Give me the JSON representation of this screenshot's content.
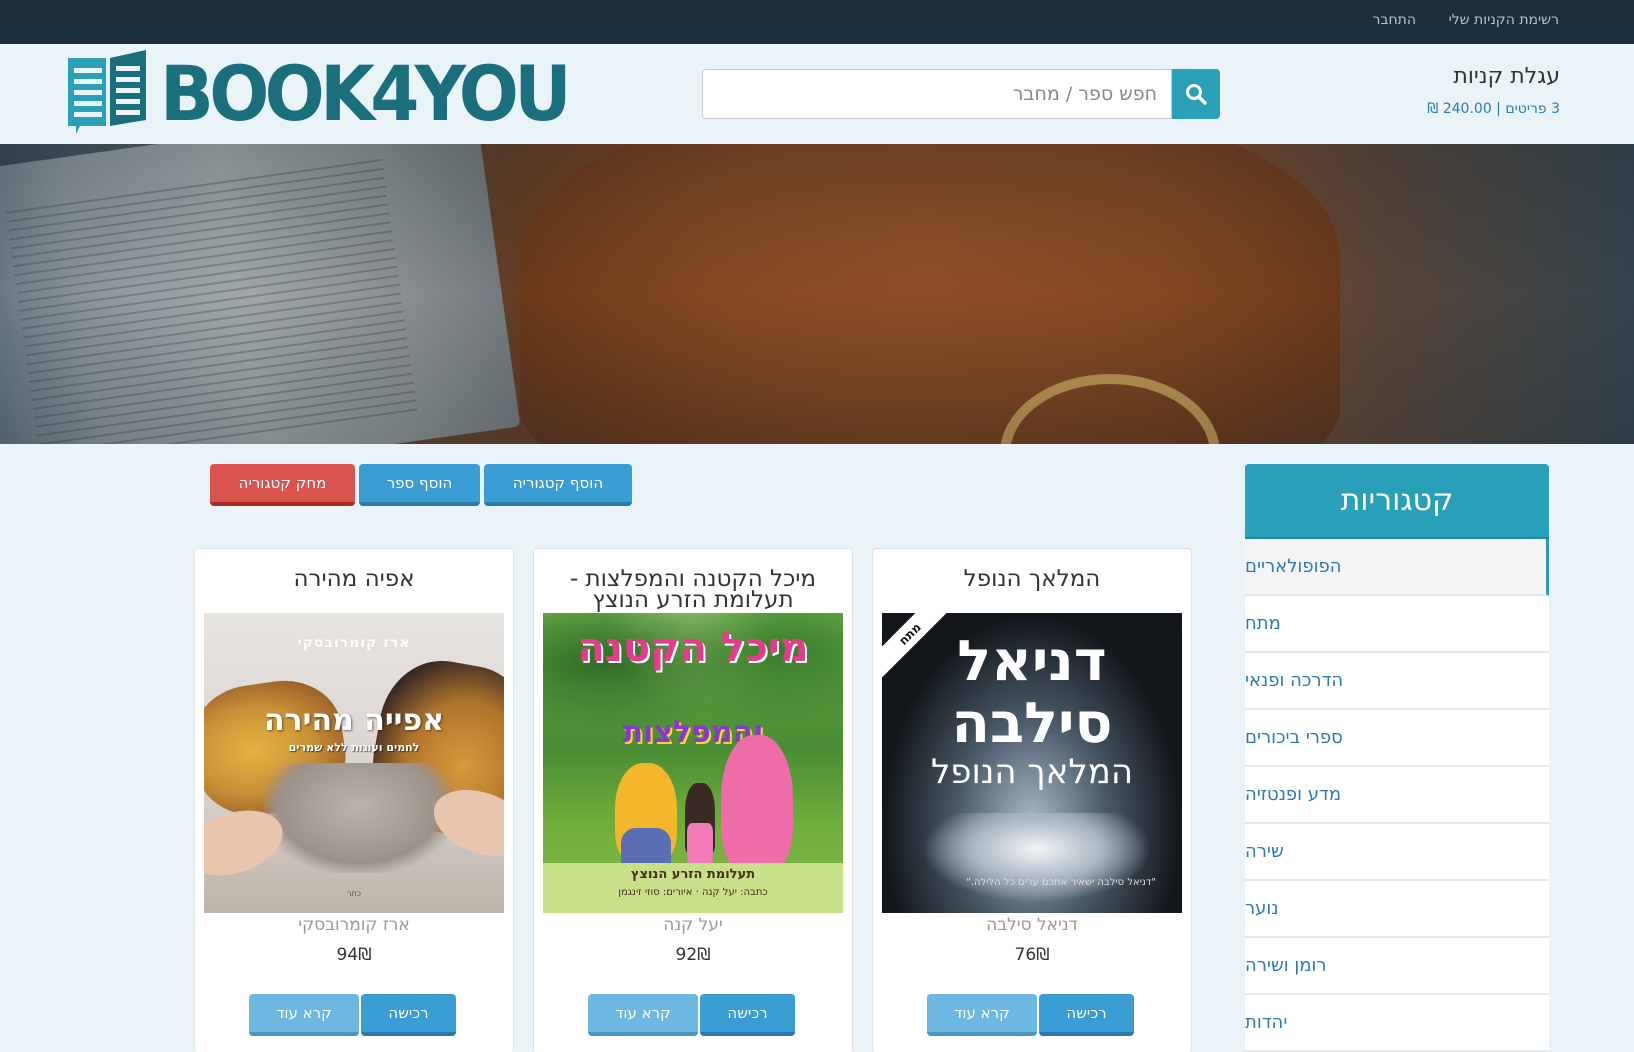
{
  "topnav": {
    "wishlist_label": "רשימת הקניות שלי",
    "login_label": "התחבר"
  },
  "header": {
    "logo_text": "BOOK4YOU",
    "search_placeholder": "חפש ספר / מחבר",
    "search_icon": "search-icon",
    "cart_title": "עגלת קניות",
    "cart_summary": "3 פריטים | 240.00 ₪"
  },
  "actions": {
    "add_category": "הוסף קטגוריה",
    "add_book": "הוסף ספר",
    "delete_category": "מחק קטגוריה"
  },
  "sidebar": {
    "title": "קטגוריות",
    "items": [
      {
        "label": "הפופולאריים",
        "active": true
      },
      {
        "label": "מתח"
      },
      {
        "label": "הדרכה ופנאי"
      },
      {
        "label": "ספרי ביכורים"
      },
      {
        "label": "מדע ופנטזיה"
      },
      {
        "label": "שירה"
      },
      {
        "label": "נוער"
      },
      {
        "label": "רומן ושירה"
      },
      {
        "label": "יהדות"
      }
    ]
  },
  "products": [
    {
      "title": "המלאך הנופל",
      "author": "דניאל סילבה",
      "price": "76₪",
      "buy_label": "רכישה",
      "more_label": "קרא עוד",
      "cover": {
        "ribbon": "מתח",
        "name": "דניאל סילבה",
        "title": "המלאך הנופל",
        "quote": "\"דניאל סילבה ישאיר אתכם ערים כל הלילה.\""
      }
    },
    {
      "title": "מיכל הקטנה והמפלצות - תעלומת הזרע הנוצץ",
      "author": "יעל קנה",
      "price": "92₪",
      "buy_label": "רכישה",
      "more_label": "קרא עוד",
      "cover": {
        "title_top": "מיכל הקטנה",
        "title_bottom": "והמפלצות",
        "subtitle": "תעלומת הזרע הנוצץ",
        "credits": "כתבה: יעל קנה · איורים: סוזי זינגמן"
      }
    },
    {
      "title": "אפיה מהירה",
      "author": "ארז קומרובסקי",
      "price": "94₪",
      "buy_label": "רכישה",
      "more_label": "קרא עוד",
      "cover": {
        "author": "ארז קומרובסקי",
        "title": "אפייה מהירה",
        "subtitle": "לחמים ועוגות ללא שמרים",
        "publisher": "כתר"
      }
    }
  ],
  "colors": {
    "topbar": "#1c2d3d",
    "accent": "#2a9fb8",
    "button_blue": "#3a9ed4",
    "button_red": "#d9534f",
    "link": "#2a7ab5"
  }
}
